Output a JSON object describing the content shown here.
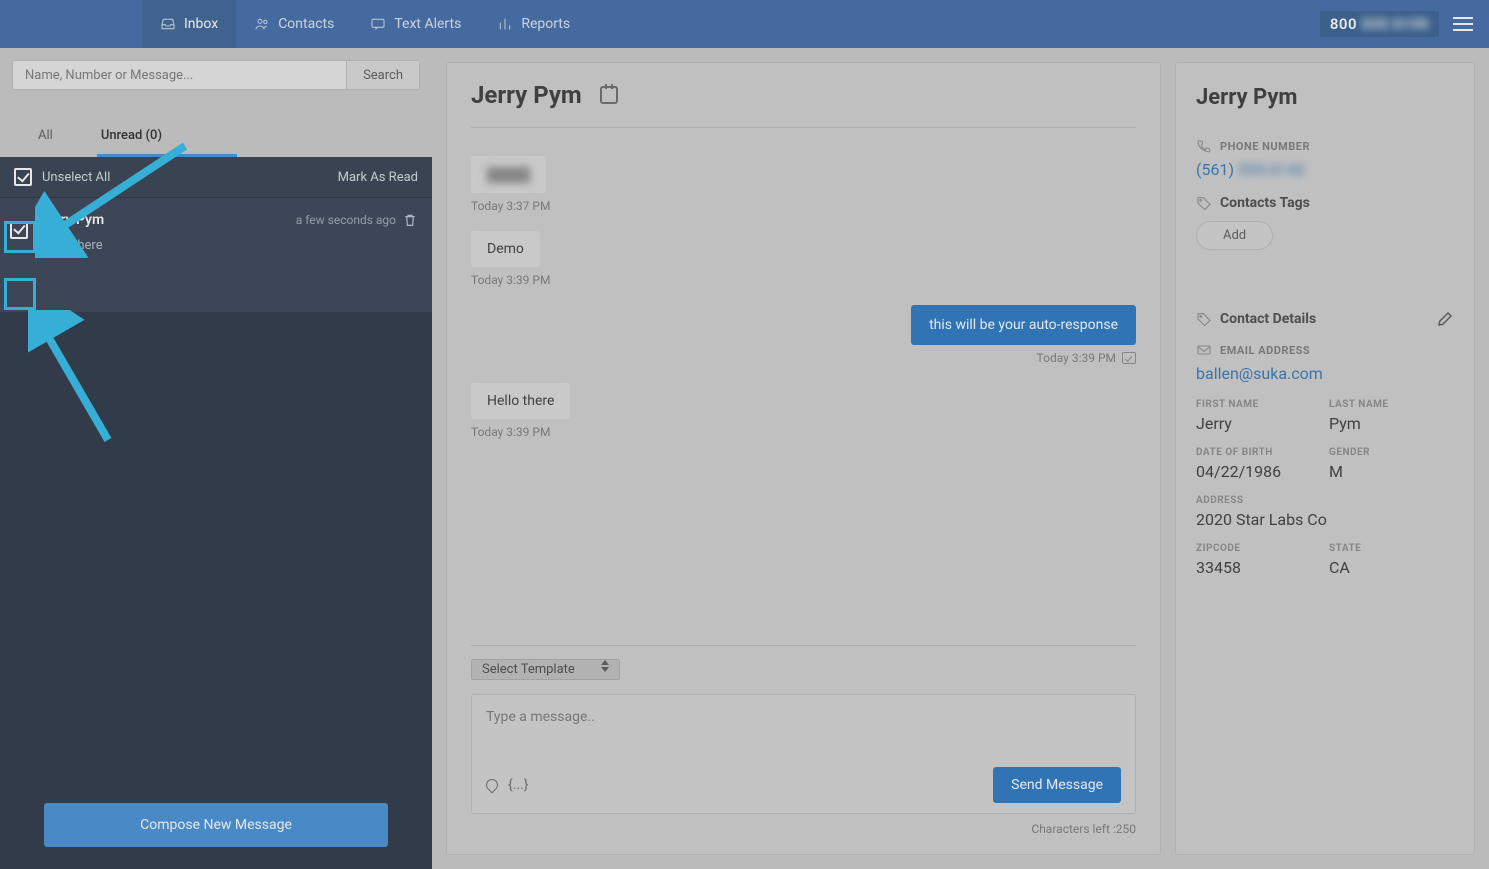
{
  "nav": {
    "inbox": "Inbox",
    "contacts": "Contacts",
    "alerts": "Text Alerts",
    "reports": "Reports",
    "phone_prefix": "800",
    "phone_rest": " 555 0199"
  },
  "search": {
    "placeholder": "Name, Number or Message...",
    "button": "Search"
  },
  "filters": {
    "all": "All",
    "unread": "Unread (0)"
  },
  "selectbar": {
    "unselect": "Unselect All",
    "mark": "Mark As Read"
  },
  "threads": [
    {
      "name": "Jerry Pym",
      "time": "a few seconds ago",
      "snippet": "Hello there"
    }
  ],
  "compose": "Compose New Message",
  "conv": {
    "title": "Jerry Pym",
    "messages": [
      {
        "dir": "in",
        "text": "██  ██",
        "time": "Today 3:37 PM",
        "blur": true
      },
      {
        "dir": "in",
        "text": "Demo",
        "time": "Today 3:39 PM"
      },
      {
        "dir": "out",
        "text": "this will be your auto-response",
        "time": "Today 3:39 PM"
      },
      {
        "dir": "in",
        "text": "Hello there",
        "time": "Today 3:39 PM"
      }
    ],
    "template": "Select Template",
    "placeholder": "Type a message..",
    "send": "Send Message",
    "brace": "{...}",
    "chars": "Characters left :250"
  },
  "details": {
    "name": "Jerry Pym",
    "phone_label": "PHONE NUMBER",
    "phone_prefix": "(561)",
    "phone_rest": " 555-0142",
    "tags_label": "Contacts Tags",
    "add": "Add",
    "cd_label": "Contact Details",
    "email_label": "EMAIL ADDRESS",
    "email": "ballen@suka.com",
    "fn_label": "FIRST NAME",
    "fn": "Jerry",
    "ln_label": "LAST NAME",
    "ln": "Pym",
    "dob_label": "DATE OF BIRTH",
    "dob": "04/22/1986",
    "gender_label": "GENDER",
    "gender": "M",
    "addr_label": "ADDRESS",
    "addr": "2020 Star Labs Co",
    "zip_label": "ZIPCODE",
    "zip": "33458",
    "state_label": "STATE",
    "state": "CA"
  }
}
